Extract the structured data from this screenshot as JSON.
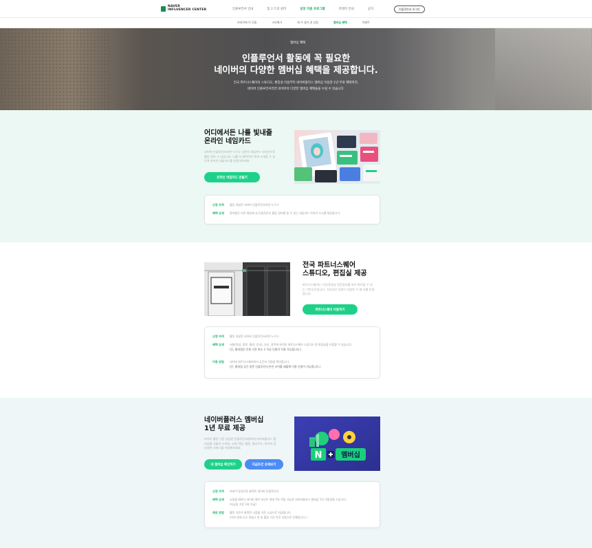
{
  "header": {
    "logo_line1": "NAVER",
    "logo_line2": "INFLUENCER CENTER",
    "menu": [
      "인플루언서 안내",
      "참 2 드의 원리",
      "성장 지원 프로그램",
      "카데미 안내",
      "공지"
    ],
    "active_menu_index": 2,
    "login_label": "인플루언서 로그인"
  },
  "subnav": {
    "items": [
      "커리어에 이 무들",
      "스타해기",
      "캐 기 설기 권 상장",
      "멤버십 혜택",
      "이벤트"
    ],
    "active_index": 3
  },
  "hero": {
    "badge": "멤버십 혜택",
    "title_line1": "인플루언서 활동에 꼭 필요한",
    "title_line2": "네이버의 다양한 멤버십 혜택을 제공합니다.",
    "desc_line1": "전국 파트너스퀘어의 스튜디오, 편집실 이용부터 네이버플러스 멤버십 이용권 1년 무료 혜택까지,",
    "desc_line2": "네이버 인플루언서라면 네이버의 다양한 멤버십 혜택들을 누릴 수 있습니다."
  },
  "section1": {
    "title_line1": "어디에서든 나를 빛내줄",
    "title_line2": "온라인 네임카드",
    "desc": "네이버 인플루언서라면 누구나 나만의 네임카드 디자인으로 활동 정보 수 있습니다. 나를 더 매력적인 에게 소개할 수 있도록 온라인 네임카드를 만들어보세요.",
    "button": "온라인 네임카드 만들기",
    "rows": [
      {
        "label": "신청 자격",
        "value": "활동 개설된 네이버 인플루언서라면 누구나"
      },
      {
        "label": "혜택 상세",
        "value": "참여중인 다른 채널에 내 인플루언서 활동 정보를 쓸 수 있는 네임카드 이미지 소스를 제공합니다."
      }
    ]
  },
  "section2": {
    "title_line1": "전국 파트너스퀘어",
    "title_line2": "스튜디오, 편집실 제공",
    "desc": "파트너스퀘어는 사진/동영상 전문장비를 보다 편리할 수 있는 기반공간입니다. 기다리던 일정이 다양한 수 혜 다룰 만큼합니다.",
    "button": "파트너스퀘어 이용하기",
    "rows": [
      {
        "label": "신청 자격",
        "value": "활동 개설된 네이버 인플루언서라면 누구나",
        "note": ""
      },
      {
        "label": "혜택 상세",
        "value": "서울(역삼, 종로, 홍대, 강서), 부산, 광주에 위치한 파트너스퀘어 스튜디오 및 편집실을 이용할 수 있습니다.",
        "note": "(단, 홍대점은 인원 기준 최소 1 이상 인원이 이용 가능합니다.)"
      },
      {
        "label": "이용 방법",
        "value": "네이버 파트너스퀘어에서 공간의 인원을 확인합니다.",
        "note": "(단, 홍대점 공간 방문 인플루언서 본인 사이를 제출해 이용 신청이 가능합니다.)"
      }
    ]
  },
  "section3": {
    "title_line1": "네이버플러스 멤버십",
    "title_line2": "1년 무료 제공",
    "desc": "카테기 활동 기준 달성한 인플루언서들에게 네이버플러스 멤버십을 선물로 드려요. 쇼핑 적립, 웹툰, 클라우드, 바이브 등 다양한 서비스를 이용해보세요.",
    "button1": "내 멤버십 확인하기",
    "button2": "지급조건 상세보기",
    "banner_text": "멤버십",
    "rows": [
      {
        "label": "신청 자격",
        "value": "카테기 달성기준 충족된 네이버 인플루언서",
        "note": ""
      },
      {
        "label": "혜택 상세",
        "value": "쇼핑할 때마다 네이버 페이 포인트 최대 5% 적립 가능한 네이버플러스 멤버십 1년 이용권을 드립니다.",
        "note": "(지급일 기준 1회 지급)"
      },
      {
        "label": "제공 방법",
        "value": "활동 기준이 충족된 시점을 기준 소급으로 지급됩니다.",
        "note": "(이번 달에 신규 개설시 첫 달 활동 기간 이후 자동으로 진행됩니다.)"
      }
    ]
  },
  "colors": {
    "accent": "#1ed18a",
    "blue": "#4d8cf5"
  }
}
